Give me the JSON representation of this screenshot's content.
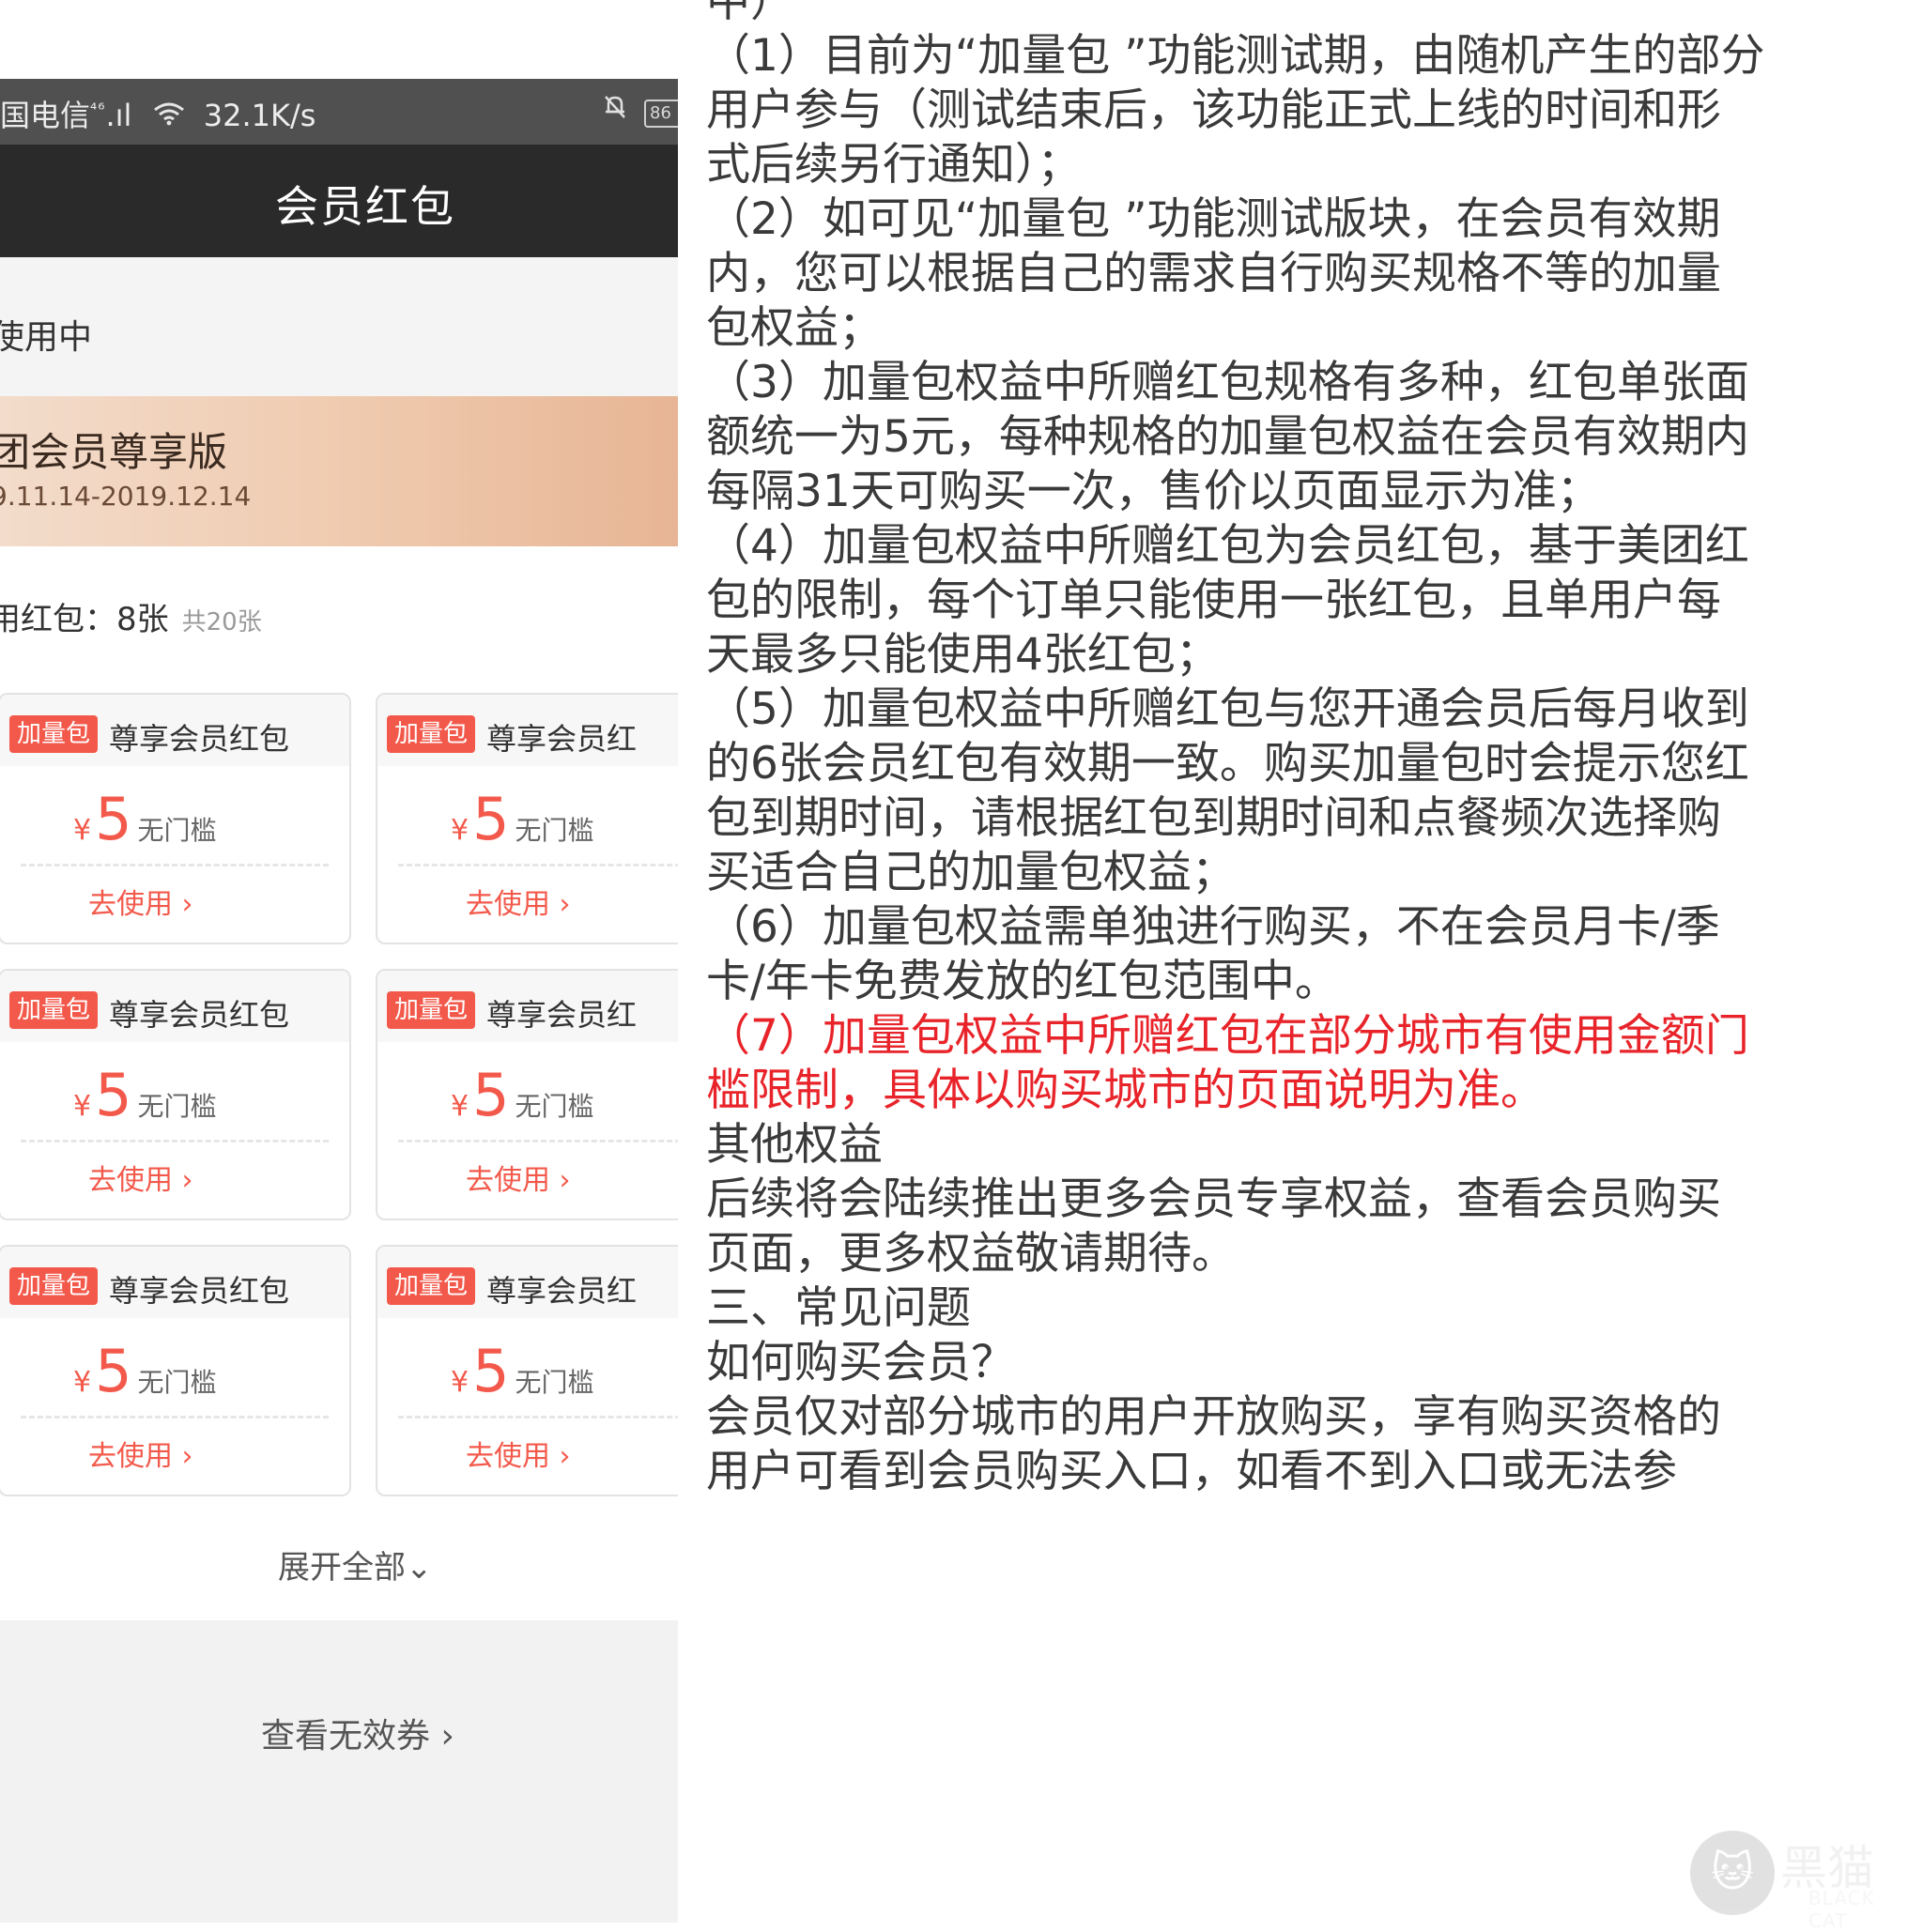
{
  "phone": {
    "status_bar": {
      "carrier": "国电信",
      "signal": "⁴⁶",
      "speed": "32.1K/s",
      "battery": "86"
    },
    "title": "会员红包",
    "section_label": "使用中",
    "member_card": {
      "name": "团会员尊享版",
      "dates": "9.11.14-2019.12.14"
    },
    "redpacket_count": {
      "label": "用红包：8张",
      "total": "共20张"
    },
    "coupons": [
      {
        "tag": "加量包",
        "title": "尊享会员红包",
        "currency": "¥",
        "amount": "5",
        "note": "无门槛",
        "action": "去使用 ›"
      },
      {
        "tag": "加量包",
        "title": "尊享会员红",
        "currency": "¥",
        "amount": "5",
        "note": "无门槛",
        "action": "去使用 ›"
      },
      {
        "tag": "加量包",
        "title": "尊享会员红包",
        "currency": "¥",
        "amount": "5",
        "note": "无门槛",
        "action": "去使用 ›"
      },
      {
        "tag": "加量包",
        "title": "尊享会员红",
        "currency": "¥",
        "amount": "5",
        "note": "无门槛",
        "action": "去使用 ›"
      },
      {
        "tag": "加量包",
        "title": "尊享会员红包",
        "currency": "¥",
        "amount": "5",
        "note": "无门槛",
        "action": "去使用 ›"
      },
      {
        "tag": "加量包",
        "title": "尊享会员红",
        "currency": "¥",
        "amount": "5",
        "note": "无门槛",
        "action": "去使用 ›"
      }
    ],
    "expand_label": "展开全部⌄",
    "invalid_label": "查看无效券 ›"
  },
  "rules": {
    "lines": [
      {
        "text": "中）",
        "red": false
      },
      {
        "text": "（1）目前为“加量包 ”功能测试期，由随机产生的部分",
        "red": false
      },
      {
        "text": "用户参与（测试结束后，该功能正式上线的时间和形",
        "red": false
      },
      {
        "text": "式后续另行通知）；",
        "red": false
      },
      {
        "text": "（2）如可见“加量包 ”功能测试版块，在会员有效期",
        "red": false
      },
      {
        "text": "内，您可以根据自己的需求自行购买规格不等的加量",
        "red": false
      },
      {
        "text": "包权益；",
        "red": false
      },
      {
        "text": "（3）加量包权益中所赠红包规格有多种，红包单张面",
        "red": false
      },
      {
        "text": "额统一为5元，每种规格的加量包权益在会员有效期内",
        "red": false
      },
      {
        "text": "每隔31天可购买一次，售价以页面显示为准；",
        "red": false
      },
      {
        "text": "（4）加量包权益中所赠红包为会员红包，基于美团红",
        "red": false
      },
      {
        "text": "包的限制，每个订单只能使用一张红包，且单用户每",
        "red": false
      },
      {
        "text": "天最多只能使用4张红包；",
        "red": false
      },
      {
        "text": "（5）加量包权益中所赠红包与您开通会员后每月收到",
        "red": false
      },
      {
        "text": "的6张会员红包有效期一致。购买加量包时会提示您红",
        "red": false
      },
      {
        "text": "包到期时间，请根据红包到期时间和点餐频次选择购",
        "red": false
      },
      {
        "text": "买适合自己的加量包权益；",
        "red": false
      },
      {
        "text": "（6）加量包权益需单独进行购买，不在会员月卡/季",
        "red": false
      },
      {
        "text": "卡/年卡免费发放的红包范围中。",
        "red": false
      },
      {
        "text": "（7）加量包权益中所赠红包在部分城市有使用金额门",
        "red": true
      },
      {
        "text": "槛限制，具体以购买城市的页面说明为准。",
        "red": true
      },
      {
        "text": "其他权益",
        "red": false
      },
      {
        "text": "后续将会陆续推出更多会员专享权益，查看会员购买",
        "red": false
      },
      {
        "text": "页面，更多权益敬请期待。",
        "red": false
      },
      {
        "text": "三、常见问题",
        "red": false
      },
      {
        "text": "如何购买会员？",
        "red": false
      },
      {
        "text": "会员仅对部分城市的用户开放购买，享有购买资格的",
        "red": false
      },
      {
        "text": "用户可看到会员购买入口，如看不到入口或无法参",
        "red": false
      }
    ]
  },
  "watermark": {
    "cn": "黑猫",
    "en": "BLACK CAT"
  },
  "colors": {
    "accent_red": "#f3594b",
    "title_bar": "#2b2a2a",
    "rule_red": "#e8242a"
  }
}
